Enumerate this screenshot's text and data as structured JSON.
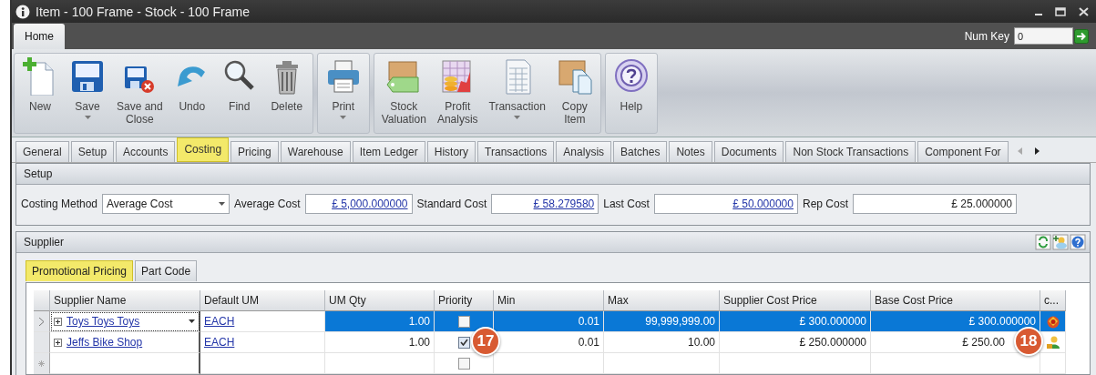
{
  "window": {
    "title": "Item - 100 Frame - Stock - 100 Frame"
  },
  "ribbon_tabs": [
    {
      "label": "Home",
      "selected": true
    }
  ],
  "num_key": {
    "label": "Num Key",
    "value": "0"
  },
  "ribbon_groups": [
    {
      "buttons": [
        {
          "lines": [
            "New"
          ],
          "dropdown": false
        },
        {
          "lines": [
            "Save"
          ],
          "dropdown": true
        },
        {
          "lines": [
            "Save and",
            "Close"
          ],
          "dropdown": false
        },
        {
          "lines": [
            "Undo"
          ],
          "dropdown": false
        },
        {
          "lines": [
            "Find"
          ],
          "dropdown": false
        },
        {
          "lines": [
            "Delete"
          ],
          "dropdown": false
        }
      ]
    },
    {
      "buttons": [
        {
          "lines": [
            "Print"
          ],
          "dropdown": true
        }
      ]
    },
    {
      "buttons": [
        {
          "lines": [
            "Stock",
            "Valuation"
          ],
          "dropdown": false
        },
        {
          "lines": [
            "Profit",
            "Analysis"
          ],
          "dropdown": false
        },
        {
          "lines": [
            "Transaction"
          ],
          "dropdown": true
        },
        {
          "lines": [
            "Copy",
            "Item"
          ],
          "dropdown": false
        }
      ]
    },
    {
      "buttons": [
        {
          "lines": [
            "Help"
          ],
          "dropdown": false
        }
      ]
    }
  ],
  "tabs": [
    {
      "label": "General",
      "selected": false
    },
    {
      "label": "Setup",
      "selected": false
    },
    {
      "label": "Accounts",
      "selected": false
    },
    {
      "label": "Costing",
      "selected": true
    },
    {
      "label": "Pricing",
      "selected": false
    },
    {
      "label": "Warehouse",
      "selected": false
    },
    {
      "label": "Item Ledger",
      "selected": false
    },
    {
      "label": "History",
      "selected": false
    },
    {
      "label": "Transactions",
      "selected": false
    },
    {
      "label": "Analysis",
      "selected": false
    },
    {
      "label": "Batches",
      "selected": false
    },
    {
      "label": "Notes",
      "selected": false
    },
    {
      "label": "Documents",
      "selected": false
    },
    {
      "label": "Non Stock Transactions",
      "selected": false
    },
    {
      "label": "Component For",
      "selected": false
    }
  ],
  "setup": {
    "title": "Setup",
    "costing_method": {
      "label": "Costing Method",
      "value": "Average Cost"
    },
    "fields": [
      {
        "label": "Average Cost",
        "value": "£ 5,000.000000",
        "kind": "link"
      },
      {
        "label": "Standard Cost",
        "value": "£ 58.279580",
        "kind": "link"
      },
      {
        "label": "Last Cost",
        "value": "£ 50.000000",
        "kind": "link"
      },
      {
        "label": "Rep Cost",
        "value": "£ 25.000000",
        "kind": "plain"
      }
    ]
  },
  "supplier": {
    "title": "Supplier",
    "sub_tabs": [
      {
        "label": "Promotional Pricing",
        "selected": true
      },
      {
        "label": "Part Code",
        "selected": false
      }
    ],
    "columns": [
      "Supplier Name",
      "Default UM",
      "UM Qty",
      "Priority",
      "Min",
      "Max",
      "Supplier Cost Price",
      "Base Cost Price",
      "c..."
    ],
    "rows": [
      {
        "selected": true,
        "supplier": "Toys Toys Toys",
        "default_um": "EACH",
        "um_qty": "1.00",
        "priority": false,
        "min": "0.01",
        "max": "99,999,999.00",
        "supplier_cost": "£ 300.000000",
        "base_cost": "£ 300.000000",
        "kind": "status"
      },
      {
        "selected": false,
        "supplier": "Jeffs Bike Shop",
        "default_um": "EACH",
        "um_qty": "1.00",
        "priority": true,
        "min": "0.01",
        "max": "10.00",
        "supplier_cost": "£ 250.000000",
        "base_cost": "£ 250.00",
        "kind": "contact",
        "priority_callout": "17",
        "base_cost_callout": "18"
      },
      {
        "selected": false,
        "kind": "new",
        "priority": false
      }
    ]
  }
}
